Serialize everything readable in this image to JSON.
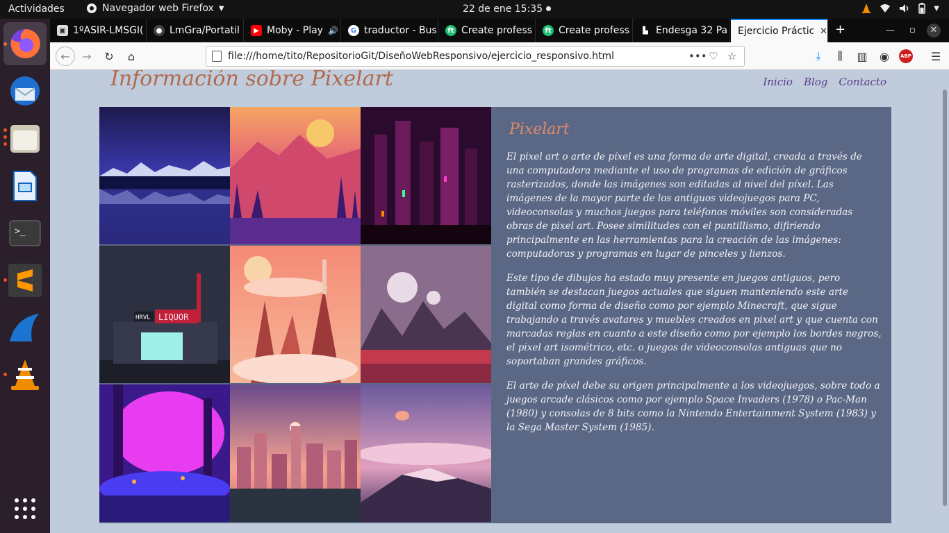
{
  "topbar": {
    "activities": "Actividades",
    "app_menu": "Navegador web Firefox",
    "clock": "22 de ene  15:35"
  },
  "dock": {
    "items": [
      {
        "name": "firefox",
        "icon": "firefox-icon"
      },
      {
        "name": "thunderbird",
        "icon": "thunderbird-icon"
      },
      {
        "name": "files",
        "icon": "folder-icon"
      },
      {
        "name": "libreoffice-writer",
        "icon": "document-icon"
      },
      {
        "name": "terminal",
        "icon": "terminal-icon"
      },
      {
        "name": "sublime-text",
        "icon": "sublime-icon"
      },
      {
        "name": "wireshark",
        "icon": "shark-fin-icon"
      },
      {
        "name": "vlc",
        "icon": "vlc-cone-icon"
      }
    ],
    "show_apps_icon": "grid-icon"
  },
  "browser": {
    "tabs": [
      {
        "title": "1ºASIR-LMSGI(",
        "icon": "moodle-icon"
      },
      {
        "title": "LmGra/Portatil",
        "icon": "github-icon"
      },
      {
        "title": "Moby - Play",
        "icon": "youtube-icon",
        "audio": "speaker-icon"
      },
      {
        "title": "traductor - Bus",
        "icon": "google-icon"
      },
      {
        "title": "Create profess",
        "icon": "ft-icon"
      },
      {
        "title": "Create profess",
        "icon": "ft-icon"
      },
      {
        "title": "Endesga 32 Pa",
        "icon": "lospec-icon"
      },
      {
        "title": "Ejercicio Práctic",
        "icon": "none",
        "selected": true
      }
    ],
    "url": "file:///home/tito/RepositorioGit/DiseñoWebResponsivo/ejercicio_responsivo.html",
    "accent": "#0a84ff"
  },
  "page": {
    "title": "Información sobre Pixelart",
    "nav": [
      "Inicio",
      "Blog",
      "Contacto"
    ],
    "article": {
      "heading": "Pixelart",
      "p1": "El pixel art o arte de píxel es una forma de arte digital, creada a través de una computadora mediante el uso de programas de edición de gráficos rasterizados, donde las imágenes son editadas al nivel del píxel. Las imágenes de la mayor parte de los antiguos videojuegos para PC, videoconsolas y muchos juegos para teléfonos móviles son consideradas obras de pixel art. Posee similitudes con el puntillismo, difiriendo principalmente en las herramientas para la creación de las imágenes: computadoras y programas en lugar de pinceles y lienzos.",
      "p2": "Este tipo de dibujos ha estado muy presente en juegos antiguos, pero también se destacan juegos actuales que siguen manteniendo este arte digital como forma de diseño como por ejemplo Minecraft, que sigue trabajando a través avatares y muebles creados en pixel art y que cuenta con marcadas reglas en cuanto a este diseño como por ejemplo los bordes negros, el pixel art isométrico, etc. o juegos de videoconsolas antiguas que no soportaban grandes gráficos.",
      "p3": "El arte de píxel debe su origen principalmente a los videojuegos, sobre todo a juegos arcade clásicos como por ejemplo Space Invaders (1978) o Pac-Man (1980) y consolas de 8 bits como la Nintendo Entertainment System (1983) y la Sega Master System (1985)."
    },
    "gallery": [
      {
        "name": "night-lake-mountains"
      },
      {
        "name": "sunset-forest"
      },
      {
        "name": "neon-city"
      },
      {
        "name": "liquor-store-night",
        "signs": [
          "HRVL",
          "LIQUOR"
        ]
      },
      {
        "name": "pink-floating-castle"
      },
      {
        "name": "purple-moons-mountains"
      },
      {
        "name": "magenta-forest"
      },
      {
        "name": "pink-city-skyline"
      },
      {
        "name": "purple-mountain-sunset"
      }
    ],
    "colors": {
      "background": "#c0cbdb",
      "panel": "#5b6885",
      "title": "#b06a4b",
      "heading": "#e08a6a",
      "nav": "#5a3e8c"
    }
  }
}
